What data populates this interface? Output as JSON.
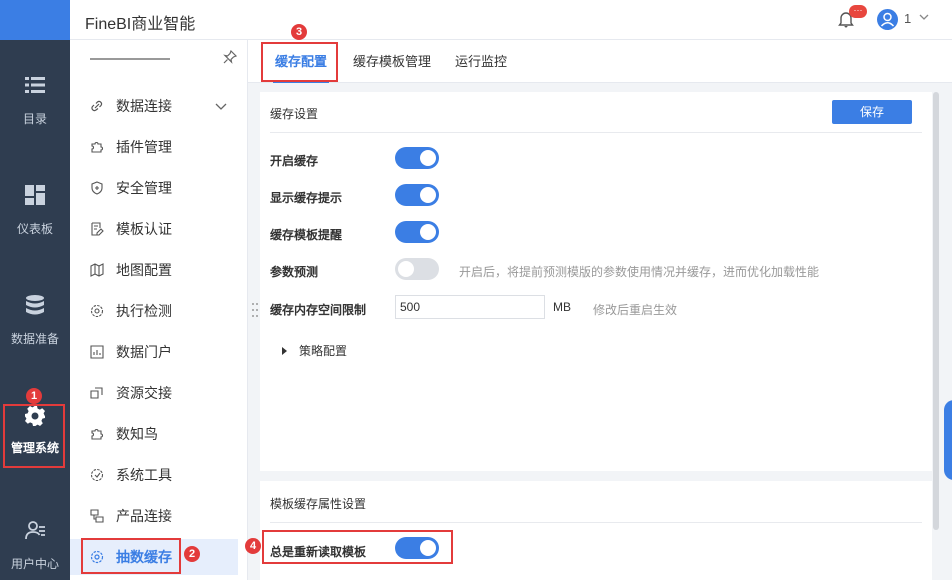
{
  "leftnav": {
    "items": [
      {
        "label": "目录",
        "icon": "list-icon"
      },
      {
        "label": "仪表板",
        "icon": "dashboard-icon"
      },
      {
        "label": "数据准备",
        "icon": "database-icon"
      },
      {
        "label": "管理系统",
        "icon": "gear-icon"
      },
      {
        "label": "用户中心",
        "icon": "user-icon"
      }
    ]
  },
  "header": {
    "title": "FineBI商业智能",
    "badge": "···",
    "user": "1"
  },
  "submenu": {
    "items": [
      {
        "label": "数据连接",
        "icon": "link-icon"
      },
      {
        "label": "插件管理",
        "icon": "puzzle-icon"
      },
      {
        "label": "安全管理",
        "icon": "shield-icon"
      },
      {
        "label": "模板认证",
        "icon": "certificate-icon"
      },
      {
        "label": "地图配置",
        "icon": "map-icon"
      },
      {
        "label": "执行检测",
        "icon": "cog-check-icon"
      },
      {
        "label": "数据门户",
        "icon": "portal-icon"
      },
      {
        "label": "资源交接",
        "icon": "exchange-icon"
      },
      {
        "label": "数知鸟",
        "icon": "puzzle-icon"
      },
      {
        "label": "系统工具",
        "icon": "tool-icon"
      },
      {
        "label": "产品连接",
        "icon": "connect-icon"
      },
      {
        "label": "抽数缓存",
        "icon": "cog-icon"
      }
    ]
  },
  "tabs": [
    "缓存配置",
    "缓存模板管理",
    "运行监控"
  ],
  "cache": {
    "section_title": "缓存设置",
    "save_label": "保存",
    "rows": [
      {
        "label": "开启缓存",
        "on": true
      },
      {
        "label": "显示缓存提示",
        "on": true
      },
      {
        "label": "缓存模板提醒",
        "on": true
      },
      {
        "label": "参数预测",
        "on": false,
        "hint": "开启后，将提前预测模版的参数使用情况并缓存，进而优化加载性能"
      }
    ],
    "memory": {
      "label": "缓存内存空间限制",
      "value": "500",
      "unit": "MB",
      "hint": "修改后重启生效"
    },
    "strategy_label": "策略配置"
  },
  "template_cache": {
    "section_title": "模板缓存属性设置",
    "reload_label": "总是重新读取模板",
    "reload_on": true
  },
  "annotations": [
    "1",
    "2",
    "3",
    "4"
  ],
  "colors": {
    "accent": "#3b7ee4",
    "nav_bg": "#2f3d50",
    "annotation": "#e33b3b"
  }
}
